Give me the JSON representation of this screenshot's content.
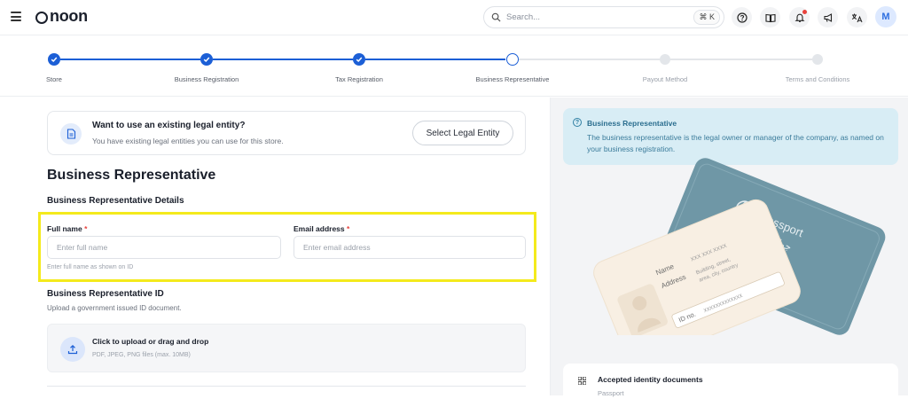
{
  "header": {
    "logo_text": "noon",
    "search_placeholder": "Search...",
    "search_shortcut": "⌘ K",
    "avatar_initial": "M",
    "icons": [
      "menu-icon",
      "help-icon",
      "book-icon",
      "bell-icon",
      "megaphone-icon",
      "translate-icon"
    ]
  },
  "stepper": {
    "steps": [
      {
        "label": "Store",
        "state": "done"
      },
      {
        "label": "Business Registration",
        "state": "done"
      },
      {
        "label": "Tax Registration",
        "state": "done"
      },
      {
        "label": "Business Representative",
        "state": "current"
      },
      {
        "label": "Payout Method",
        "state": "todo"
      },
      {
        "label": "Terms and Conditions",
        "state": "todo"
      }
    ]
  },
  "entity": {
    "title": "Want to use an existing legal entity?",
    "subtitle": "You have existing legal entities you can use for this store.",
    "button": "Select Legal Entity"
  },
  "form": {
    "title": "Business Representative",
    "section": "Business Representative Details",
    "full_name_label": "Full name",
    "full_name_placeholder": "Enter full name",
    "full_name_helper": "Enter full name as shown on ID",
    "email_label": "Email address",
    "email_placeholder": "Enter email address",
    "required_mark": "*",
    "id_title": "Business Representative ID",
    "id_subtitle": "Upload a government issued ID document.",
    "upload_title": "Click to upload or drag and drop",
    "upload_subtitle": "PDF, JPEG, PNG files (max. 10MB)"
  },
  "info": {
    "title": "Business Representative",
    "text": "The business representative is the legal owner or manager of the company, as named on your business registration."
  },
  "illustration": {
    "passport_text": "Passport",
    "passport_arabic": "جواز سفر",
    "card_name_label": "Name",
    "card_name_value": "XXX XXX XXXX",
    "card_address_label": "Address",
    "card_address_value1": "Building, street,",
    "card_address_value2": "area, city, country",
    "card_id_label": "ID no.",
    "card_id_value": "XXXXXXXXXXXXX"
  },
  "accepted": {
    "title": "Accepted identity documents",
    "first": "Passport"
  },
  "colors": {
    "primary": "#1c5fd6",
    "highlight": "#f4ea1c",
    "info_bg": "#d8edf5",
    "passport": "#6f97a6"
  }
}
